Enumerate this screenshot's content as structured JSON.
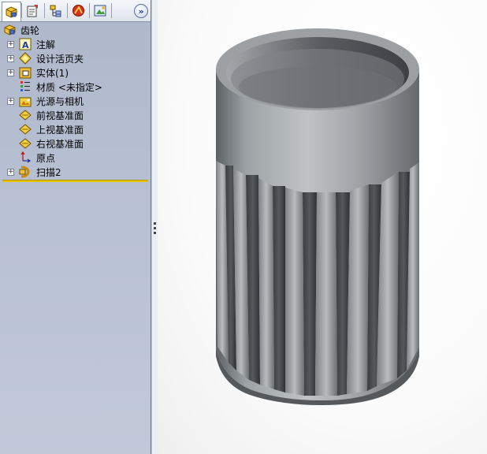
{
  "feature_tree": {
    "tabs": [
      {
        "name": "feature-manager-tab",
        "icon": "feature-manager-icon",
        "active": true
      },
      {
        "name": "property-manager-tab",
        "icon": "property-manager-icon",
        "active": false
      },
      {
        "name": "configuration-manager-tab",
        "icon": "configuration-manager-icon",
        "active": false
      },
      {
        "name": "dimxpert-tab",
        "icon": "dimxpert-icon",
        "active": false
      },
      {
        "name": "display-manager-tab",
        "icon": "display-manager-icon",
        "active": false
      }
    ],
    "expand_glyph": "»",
    "root": {
      "label": "齿轮",
      "icon": "part-icon"
    },
    "nodes": [
      {
        "label": "注解",
        "icon": "annotations-icon",
        "expandable": true
      },
      {
        "label": "设计活页夹",
        "icon": "design-binder-icon",
        "expandable": true
      },
      {
        "label": "实体(1)",
        "icon": "solid-bodies-icon",
        "expandable": true
      },
      {
        "label": "材质 <未指定>",
        "icon": "material-icon",
        "expandable": false
      },
      {
        "label": "光源与相机",
        "icon": "lights-cameras-icon",
        "expandable": true
      },
      {
        "label": "前视基准面",
        "icon": "plane-icon",
        "expandable": false
      },
      {
        "label": "上视基准面",
        "icon": "plane-icon",
        "expandable": false
      },
      {
        "label": "右视基准面",
        "icon": "plane-icon",
        "expandable": false
      },
      {
        "label": "原点",
        "icon": "origin-icon",
        "expandable": false
      },
      {
        "label": "扫描2",
        "icon": "sweep-feature-icon",
        "expandable": true
      }
    ],
    "plus_glyph": "+"
  },
  "colors": {
    "panel_bg": "#b7c0d2",
    "rollback_bar": "#e8c400",
    "part_body": "#8e9396",
    "viewport_bg": "#ffffff"
  }
}
